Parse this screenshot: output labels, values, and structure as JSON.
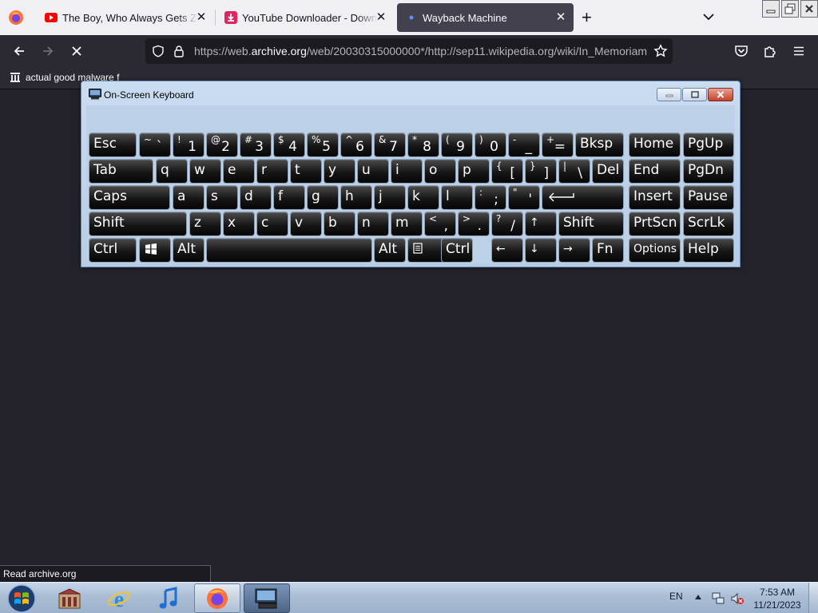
{
  "browser": {
    "tabs": [
      {
        "label": "The Boy, Who Always Gets Zero",
        "favicon": "youtube-icon",
        "active": false
      },
      {
        "label": "YouTube Downloader - Download",
        "favicon": "download-icon",
        "active": false
      },
      {
        "label": "Wayback Machine",
        "favicon": "loading-dot-icon",
        "active": true
      }
    ],
    "url_prefix": "https://web.",
    "url_host": "archive.org",
    "url_rest": "/web/20030315000000*/http://sep11.wikipedia.org/wiki/In_Memoriam",
    "bookmark": "actual good malware f",
    "status": "Read archive.org",
    "colors": {
      "tabstrip": "#f0f0f4",
      "toolbar": "#2b2a33",
      "active_tab": "#42414d",
      "content": "#23222b"
    }
  },
  "osk": {
    "title": "On-Screen Keyboard",
    "rows": [
      [
        {
          "main": "Esc"
        },
        {
          "top": "~",
          "bot": "`"
        },
        {
          "top": "!",
          "bot": "1"
        },
        {
          "top": "@",
          "bot": "2"
        },
        {
          "top": "#",
          "bot": "3"
        },
        {
          "top": "$",
          "bot": "4"
        },
        {
          "top": "%",
          "bot": "5"
        },
        {
          "top": "^",
          "bot": "6"
        },
        {
          "top": "&",
          "bot": "7"
        },
        {
          "top": "*",
          "bot": "8"
        },
        {
          "top": "(",
          "bot": "9"
        },
        {
          "top": ")",
          "bot": "0"
        },
        {
          "top": "-",
          "bot": "_"
        },
        {
          "top": "+",
          "bot": "="
        },
        {
          "main": "Bksp"
        },
        {
          "main": "Home"
        },
        {
          "main": "PgUp"
        }
      ],
      [
        {
          "main": "Tab"
        },
        {
          "main": "q"
        },
        {
          "main": "w"
        },
        {
          "main": "e"
        },
        {
          "main": "r"
        },
        {
          "main": "t"
        },
        {
          "main": "y"
        },
        {
          "main": "u"
        },
        {
          "main": "i"
        },
        {
          "main": "o"
        },
        {
          "main": "p"
        },
        {
          "top": "{",
          "bot": "["
        },
        {
          "top": "}",
          "bot": "]"
        },
        {
          "top": "|",
          "bot": "\\"
        },
        {
          "main": "Del"
        },
        {
          "main": "End"
        },
        {
          "main": "PgDn"
        }
      ],
      [
        {
          "main": "Caps"
        },
        {
          "main": "a"
        },
        {
          "main": "s"
        },
        {
          "main": "d"
        },
        {
          "main": "f"
        },
        {
          "main": "g"
        },
        {
          "main": "h"
        },
        {
          "main": "j"
        },
        {
          "main": "k"
        },
        {
          "main": "l"
        },
        {
          "top": ":",
          "bot": ";"
        },
        {
          "top": "\"",
          "bot": "'"
        },
        {
          "icon": "enter-arrow-icon"
        },
        {
          "main": "Insert"
        },
        {
          "main": "Pause"
        }
      ],
      [
        {
          "main": "Shift"
        },
        {
          "main": "z"
        },
        {
          "main": "x"
        },
        {
          "main": "c"
        },
        {
          "main": "v"
        },
        {
          "main": "b"
        },
        {
          "main": "n"
        },
        {
          "main": "m"
        },
        {
          "top": "<",
          "bot": ","
        },
        {
          "top": ">",
          "bot": "."
        },
        {
          "top": "?",
          "bot": "/"
        },
        {
          "small": "↑"
        },
        {
          "main": "Shift"
        },
        {
          "main": "PrtScn"
        },
        {
          "main": "ScrLk"
        }
      ],
      [
        {
          "main": "Ctrl"
        },
        {
          "icon": "windows-logo-icon"
        },
        {
          "main": "Alt"
        },
        {
          "main": ""
        },
        {
          "main": "Alt"
        },
        {
          "icon": "menu-key-icon"
        },
        {
          "main": "Ctrl"
        },
        {
          "small": "←"
        },
        {
          "small": "↓"
        },
        {
          "small": "→"
        },
        {
          "main": "Fn"
        },
        {
          "small": "Options"
        },
        {
          "main": "Help"
        }
      ]
    ]
  },
  "taskbar": {
    "apps": [
      "start-orb-icon",
      "archive-app-icon",
      "internet-explorer-icon",
      "itunes-icon",
      "firefox-icon",
      "on-screen-keyboard-icon"
    ],
    "language": "EN",
    "time": "7:53 AM",
    "date": "11/21/2023"
  }
}
